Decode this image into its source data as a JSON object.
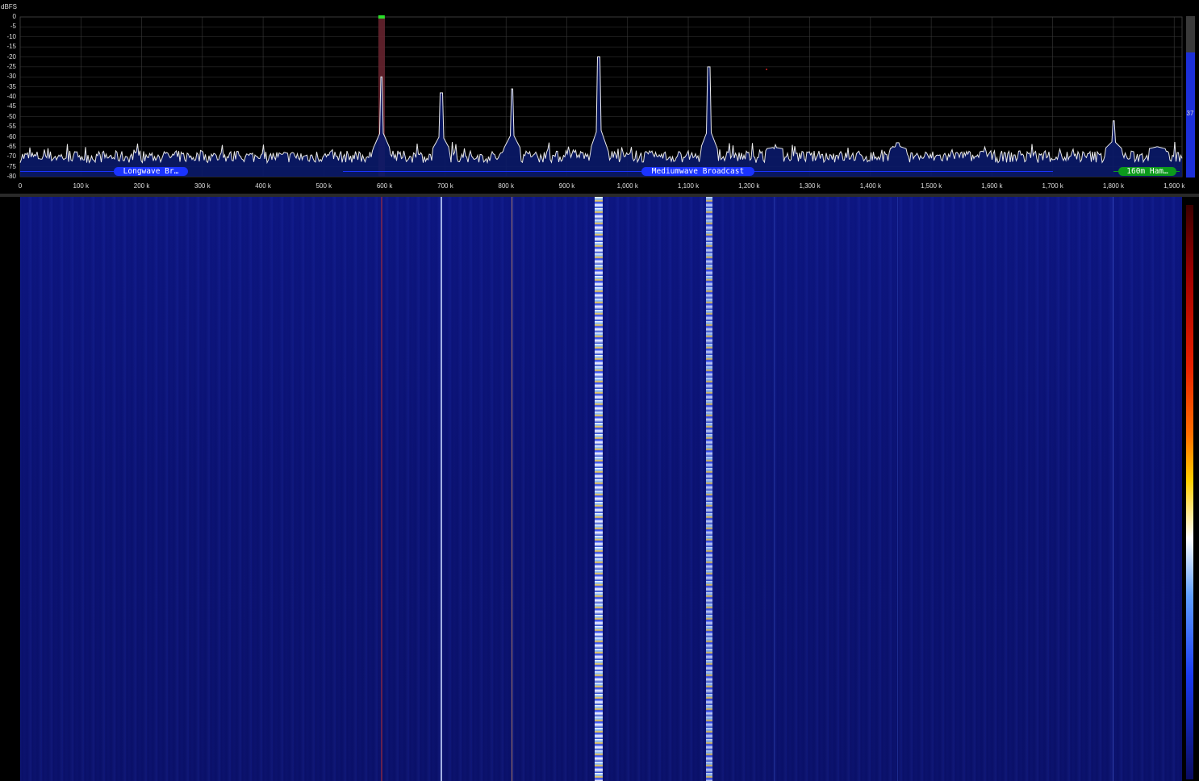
{
  "spectrum": {
    "unit_label": "dBFS",
    "db_labels": [
      "0",
      "-5",
      "-10",
      "-15",
      "-20",
      "-25",
      "-30",
      "-35",
      "-40",
      "-45",
      "-50",
      "-55",
      "-60",
      "-65",
      "-70",
      "-75",
      "-80"
    ],
    "freq_labels": [
      "0",
      "100 k",
      "200 k",
      "300 k",
      "400 k",
      "500 k",
      "600 k",
      "700 k",
      "800 k",
      "900 k",
      "1,000 k",
      "1,100 k",
      "1,200 k",
      "1,300 k",
      "1,400 k",
      "1,500 k",
      "1,600 k",
      "1,700 k",
      "1,800 k",
      "1,900 k"
    ],
    "tuned_marker_khz": 595,
    "bands": [
      {
        "label": "Longwave Br…",
        "color": "#1a33ff"
      },
      {
        "label": "Mediumwave Broadcast",
        "color": "#1a33ff"
      },
      {
        "label": "160m Ham…",
        "color": "#0c9a1c"
      }
    ],
    "peaks_khz_dbfs": [
      [
        595,
        -30
      ],
      [
        693,
        -38
      ],
      [
        810,
        -36
      ],
      [
        953,
        -20
      ],
      [
        1134,
        -25
      ],
      [
        1242,
        -66
      ],
      [
        1445,
        -63
      ],
      [
        1800,
        -52
      ],
      [
        1872,
        -65
      ]
    ],
    "noise_floor_dbfs": -69,
    "colors": {
      "trace": "#e8e8e8",
      "fill": "#0a1a6a",
      "grid": "#3a3a3a",
      "marker": "#6b2430"
    }
  },
  "controls": {
    "gain_value": "37",
    "gain_fraction": 0.37
  },
  "waterfall": {
    "signal_lines_khz": [
      {
        "khz": 595,
        "color": "#c23030",
        "width": 2,
        "strength": 0.5
      },
      {
        "khz": 693,
        "color": "#c8d8ff",
        "width": 2,
        "strength": 0.8
      },
      {
        "khz": 810,
        "color": "#e8a060",
        "width": 1,
        "strength": 0.7
      },
      {
        "khz": 953,
        "color": "#ffffff",
        "width": 10,
        "strength": 1.0
      },
      {
        "khz": 1134,
        "color": "#dfe8ff",
        "width": 8,
        "strength": 0.9
      },
      {
        "khz": 1242,
        "color": "#3a56c8",
        "width": 1,
        "strength": 0.4
      },
      {
        "khz": 1445,
        "color": "#3a56c8",
        "width": 1,
        "strength": 0.4
      },
      {
        "khz": 1800,
        "color": "#5a78ff",
        "width": 1,
        "strength": 0.5
      }
    ]
  }
}
